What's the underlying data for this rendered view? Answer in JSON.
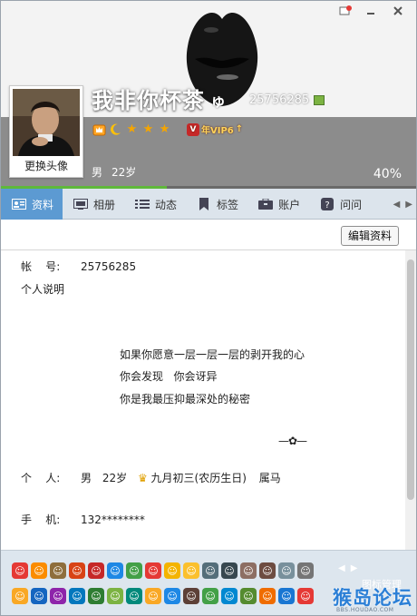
{
  "window": {
    "controls": [
      "feedback",
      "minimize",
      "close"
    ]
  },
  "profile": {
    "nickname": "我非你杯茶",
    "nick_symbol": "ゅ",
    "qq_number": "25756285",
    "avatar_caption": "更换头像",
    "gender": "男",
    "age": "22岁",
    "completion": "40%",
    "completion_value": 0.4,
    "vip_label": "年VIP6",
    "vip_arrow": "↑",
    "level_icons": [
      "crown-icon",
      "moon-icon",
      "star-icon",
      "star-icon",
      "star-icon"
    ]
  },
  "tabs": [
    {
      "label": "资料",
      "icon": "profile-card-icon",
      "active": true
    },
    {
      "label": "相册",
      "icon": "album-icon",
      "active": false
    },
    {
      "label": "动态",
      "icon": "feed-icon",
      "active": false
    },
    {
      "label": "标签",
      "icon": "tag-icon",
      "active": false
    },
    {
      "label": "账户",
      "icon": "wallet-icon",
      "active": false
    },
    {
      "label": "问问",
      "icon": "question-icon",
      "active": false
    }
  ],
  "details": {
    "edit_button": "编辑资料",
    "account_label": "帐    号:",
    "account_value": "25756285",
    "bio_label": "个人说明",
    "bio_lines": [
      "如果你愿意一层一层一层的剥开我的心",
      "你会发现   你会讶异",
      "你是我最压抑最深处的秘密"
    ],
    "bio_flourish": "—✿—",
    "personal_label": "个    人:",
    "personal_gender": "男",
    "personal_age": "22岁",
    "birthday": "九月初三(农历生日)",
    "zodiac": "属马",
    "phone_label": "手    机:",
    "phone_value": "132********"
  },
  "emoticons": {
    "manage_label": "图标管理",
    "row1_colors": [
      "#e53935",
      "#fb8c00",
      "#8e6e3c",
      "#d84315",
      "#c62828",
      "#1e88e5",
      "#43a047",
      "#e53935",
      "#f4b400",
      "#fbc02d",
      "#546e7a",
      "#37474f",
      "#8d6e63",
      "#6d4c41",
      "#78909c",
      "#757575"
    ],
    "row2_colors": [
      "#f9a825",
      "#1565c0",
      "#8e24aa",
      "#0277bd",
      "#2e7d32",
      "#7cb342",
      "#00897b",
      "#f9a825",
      "#1e88e5",
      "#5d4037",
      "#43a047",
      "#0288d1",
      "#558b2f",
      "#ef6c00",
      "#1976d2",
      "#e53935"
    ]
  },
  "watermark": {
    "text": "猴岛论坛",
    "url": "BBS.HOUDAO.COM"
  }
}
